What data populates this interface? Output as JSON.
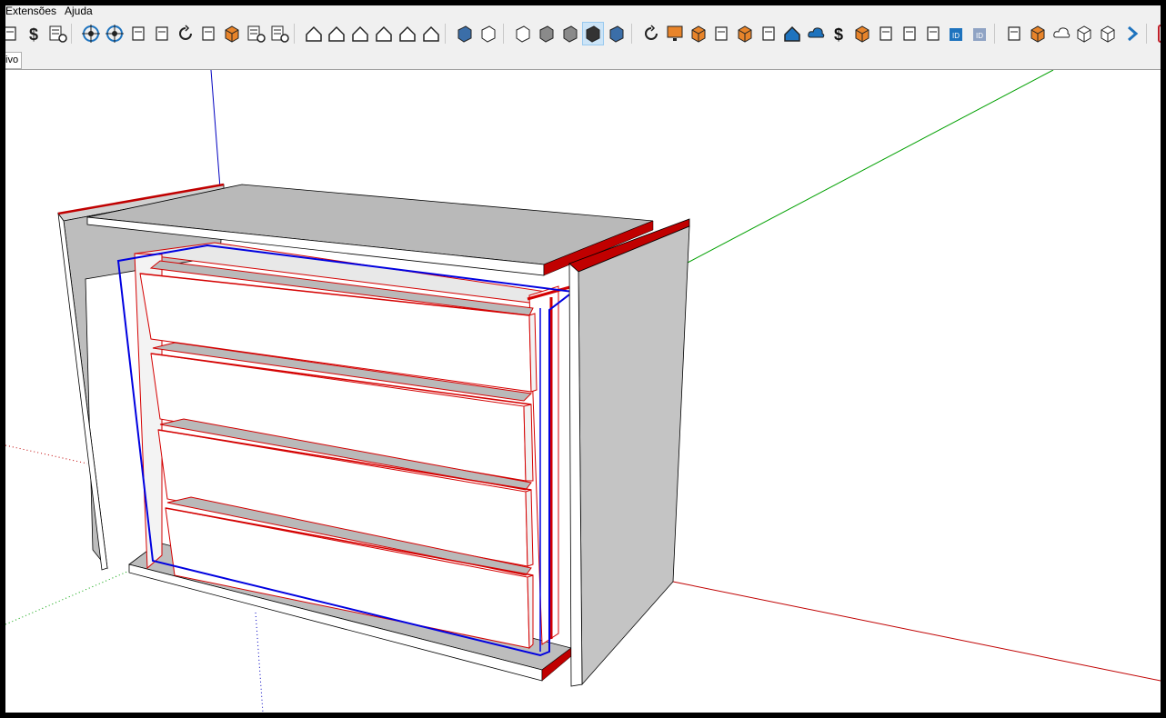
{
  "menu": {
    "extensions": "Extensões",
    "help": "Ajuda"
  },
  "scene_tab": {
    "label": "ivo"
  },
  "toolbar": {
    "icons": [
      "cut-page-icon",
      "dollar-report-icon",
      "report-list-icon",
      "target-icon",
      "target-alt-icon",
      "door-panel-icon",
      "door-handle-icon",
      "rotate-icon",
      "edit-sheet-icon",
      "search-box-icon",
      "list-add-icon",
      "list-remove-icon",
      "iso-view-icon",
      "front-view-icon",
      "home-view-icon",
      "top-view-icon",
      "house-outline-icon",
      "back-view-icon",
      "xray-style-icon",
      "wireframe-style-icon",
      "hidden-line-style-icon",
      "shaded-style-icon",
      "shaded-texture-style-icon",
      "monochrome-style-icon",
      "solid-style-icon",
      "spiral-icon",
      "monitor-icon",
      "cabinet-icon",
      "staircase-icon",
      "box-3d-icon",
      "guitar-icon",
      "house-blue-icon",
      "cloud-upload-icon",
      "dollar-icon",
      "cube-orange-icon",
      "phone-tool-icon",
      "binoculars-icon",
      "panel-tool-icon",
      "id-tag-icon",
      "id-tag-gray-icon",
      "export-icon",
      "checkbox-icon",
      "cloud-icon",
      "cube-outline-icon",
      "gear-cube-icon",
      "arrow-right-icon",
      "plugin-logo-icon"
    ],
    "active_icon": "monochrome-style-icon",
    "colors": {
      "blue": "#1e73be",
      "orange": "#e8842a",
      "dark": "#222222",
      "red": "#c0202a"
    }
  },
  "viewport": {
    "background": "#ffffff",
    "axis_colors": {
      "red": "#c00000",
      "green": "#00a000",
      "blue": "#0000c0"
    },
    "model_colors": {
      "panel_top": "#b9b9b9",
      "panel_side": "#c4c4c4",
      "panel_face": "#ffffff",
      "edge_selected": "#d40000",
      "highlight_blue": "#0000e0"
    }
  }
}
